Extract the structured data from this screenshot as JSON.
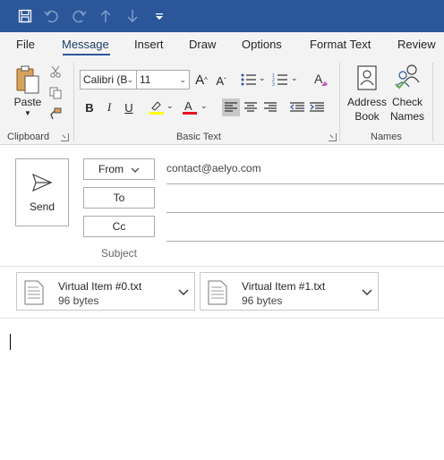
{
  "qat": {
    "icons": [
      "save-icon",
      "undo-icon",
      "redo-icon",
      "up-arrow-icon",
      "down-arrow-icon",
      "customize-qat-icon"
    ]
  },
  "tabs": [
    {
      "label": "File"
    },
    {
      "label": "Message"
    },
    {
      "label": "Insert"
    },
    {
      "label": "Draw"
    },
    {
      "label": "Options"
    },
    {
      "label": "Format Text"
    },
    {
      "label": "Review"
    }
  ],
  "ribbon": {
    "clipboard": {
      "paste_label": "Paste",
      "group_label": "Clipboard"
    },
    "basic_text": {
      "font_name": "Calibri (B",
      "font_size": "11",
      "group_label": "Basic Text"
    },
    "names": {
      "address_book_line1": "Address",
      "address_book_line2": "Book",
      "check_names_line1": "Check",
      "check_names_line2": "Names",
      "group_label": "Names"
    }
  },
  "header": {
    "send_label": "Send",
    "from_label": "From",
    "from_value": "contact@aelyo.com",
    "to_label": "To",
    "cc_label": "Cc",
    "subject_label": "Subject"
  },
  "attachments": [
    {
      "name": "Virtual Item #0.txt",
      "size": "96 bytes"
    },
    {
      "name": "Virtual Item #1.txt",
      "size": "96 bytes"
    }
  ],
  "colors": {
    "accent": "#2b579a",
    "highlight": "#ffff00",
    "font_color": "#e81123"
  }
}
